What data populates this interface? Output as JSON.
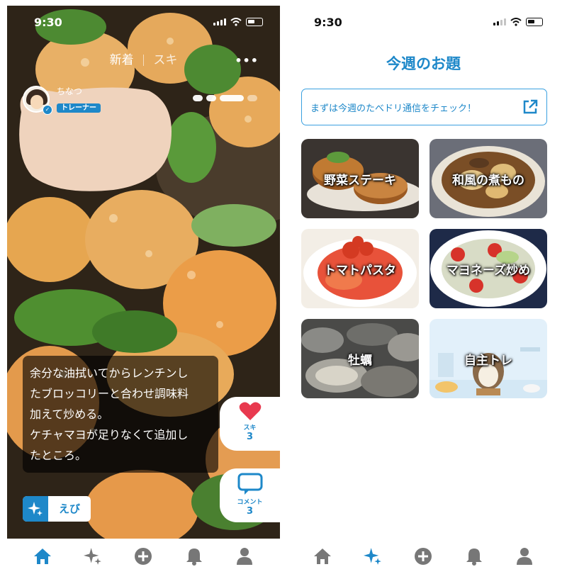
{
  "left_screen": {
    "status": {
      "time": "9:30"
    },
    "top_tabs": [
      "新着",
      "スキ"
    ],
    "user": {
      "name": "ちなつ",
      "badge": "トレーナー"
    },
    "caption_lines": [
      "余分な油拭いてからレンチンし",
      "たブロッコリーと合わせ調味料",
      "加えて炒める。",
      "ケチャマヨが足りなくて追加し",
      "たところ。"
    ],
    "like": {
      "label": "スキ",
      "count": "3"
    },
    "comment": {
      "label": "コメント",
      "count": "3"
    },
    "tag": {
      "label": "えび"
    },
    "tabbar_icons": [
      "home-icon",
      "sparkle-icon",
      "plus-circle-icon",
      "bell-icon",
      "person-icon"
    ],
    "accent": "#1e88c9"
  },
  "right_screen": {
    "status": {
      "time": "9:30"
    },
    "title": "今週のお題",
    "newsletter": "まずは今週のたべドリ通信をチェック！",
    "themes": [
      "野菜ステーキ",
      "和風の煮もの",
      "トマトパスタ",
      "マヨネーズ炒め",
      "牡蠣",
      "自主トレ"
    ],
    "tabbar_icons": [
      "home-icon",
      "sparkle-icon",
      "plus-circle-icon",
      "bell-icon",
      "person-icon"
    ]
  }
}
